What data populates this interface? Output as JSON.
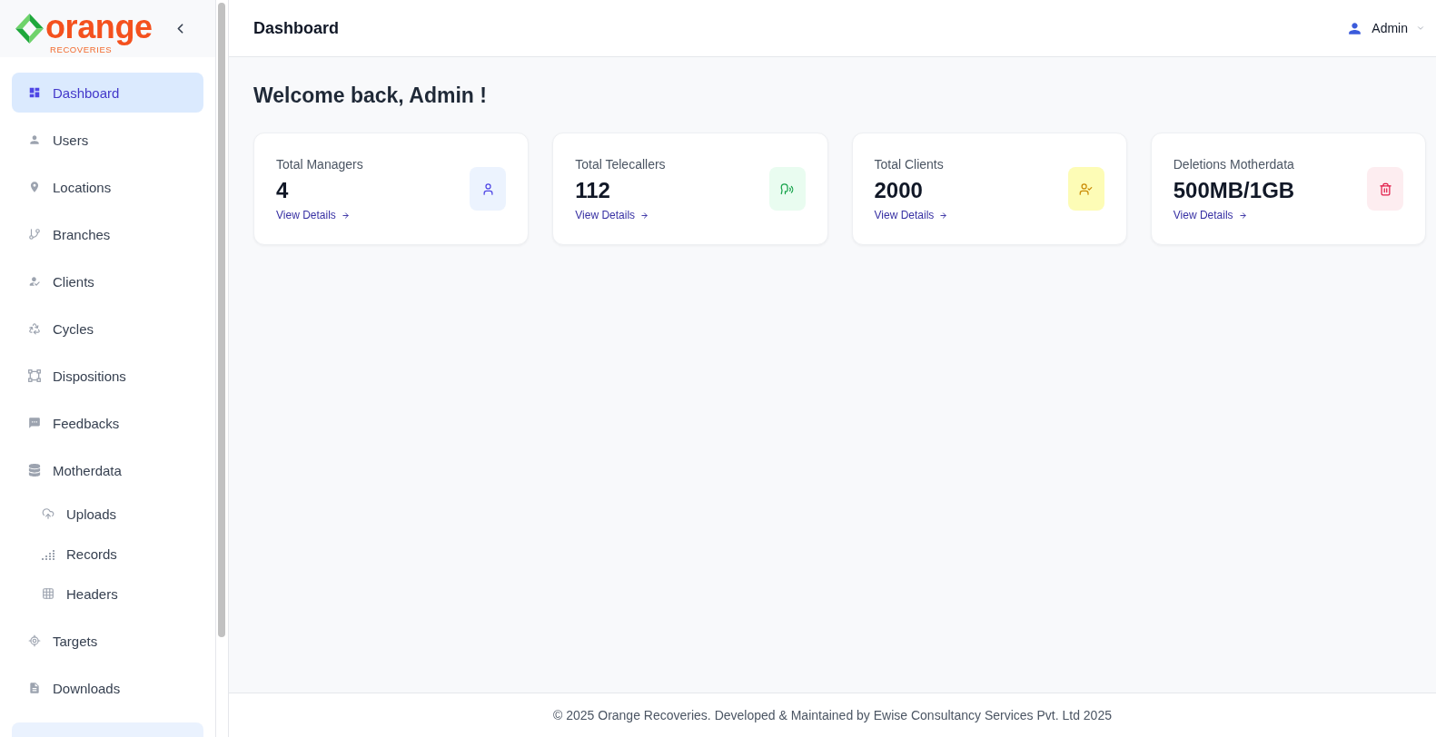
{
  "sidebar": {
    "logo": {
      "name": "orange",
      "tagline": "RECOVERIES"
    },
    "items": [
      {
        "label": "Dashboard",
        "selected": true
      },
      {
        "label": "Users",
        "selected": false
      },
      {
        "label": "Locations",
        "selected": false
      },
      {
        "label": "Branches",
        "selected": false
      },
      {
        "label": "Clients",
        "selected": false
      },
      {
        "label": "Cycles",
        "selected": false
      },
      {
        "label": "Dispositions",
        "selected": false
      },
      {
        "label": "Feedbacks",
        "selected": false
      },
      {
        "label": "Motherdata",
        "selected": false,
        "children": [
          {
            "label": "Uploads",
            "selected": false
          },
          {
            "label": "Records",
            "selected": false
          },
          {
            "label": "Headers",
            "selected": false
          }
        ]
      },
      {
        "label": "Targets",
        "selected": false
      },
      {
        "label": "Downloads",
        "selected": false
      }
    ]
  },
  "header": {
    "title": "Dashboard",
    "user": "Admin"
  },
  "welcome": "Welcome back, Admin !",
  "cards": [
    {
      "label": "Total Managers",
      "value": "4",
      "link": "View Details",
      "color": "#ecf3fe"
    },
    {
      "label": "Total Telecallers",
      "value": "112",
      "link": "View Details",
      "color": "#e9fcf0"
    },
    {
      "label": "Total Clients",
      "value": "2000",
      "link": "View Details",
      "color": "#fdfcb6"
    },
    {
      "label": "Deletions Motherdata",
      "value": "500MB/1GB",
      "link": "View Details",
      "color": "#fdedf0"
    }
  ],
  "footer": "© 2025 Orange Recoveries. Developed & Maintained by Ewise Consultancy Services Pvt. Ltd 2025"
}
